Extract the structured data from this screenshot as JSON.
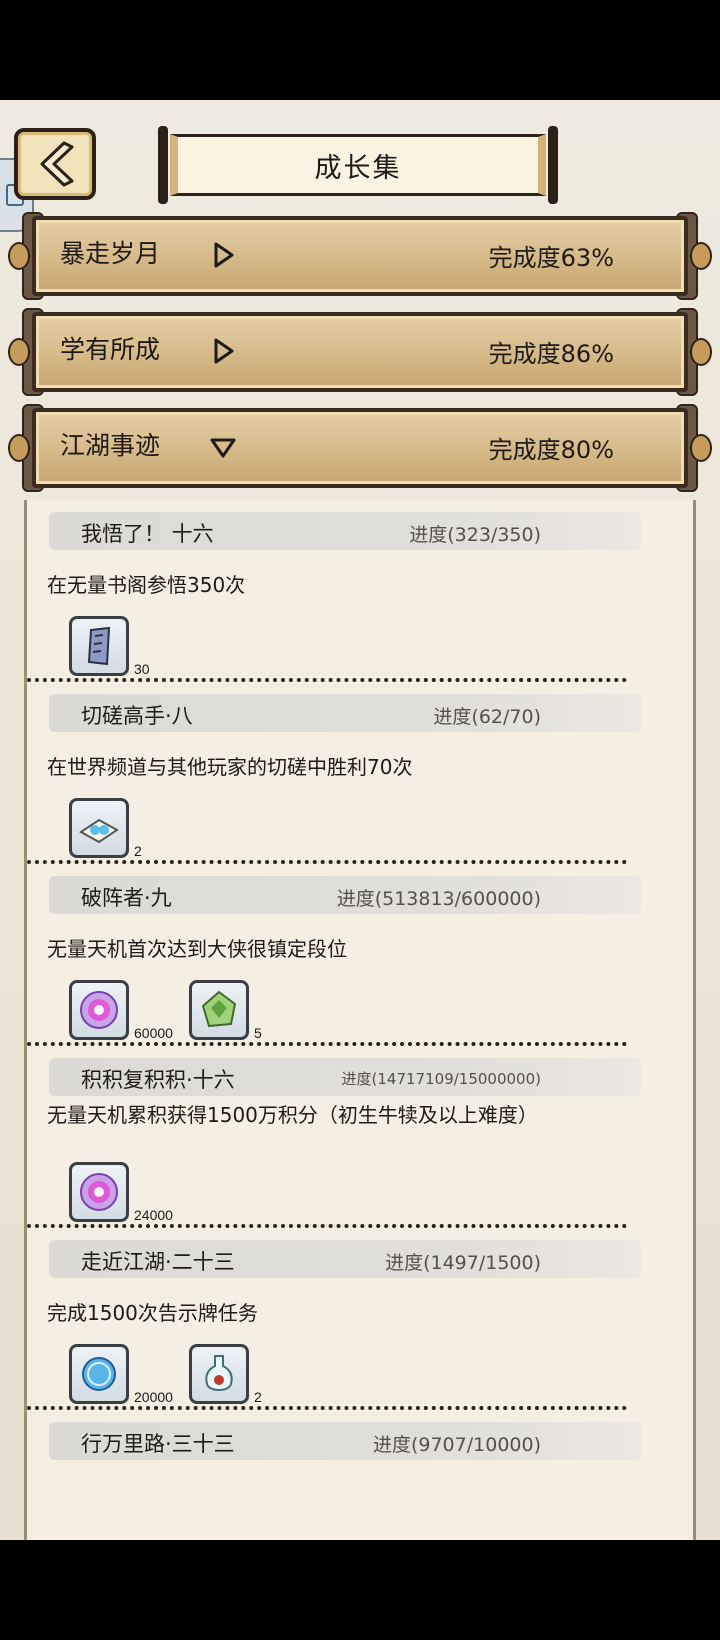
{
  "header": {
    "title": "成长集"
  },
  "categories": [
    {
      "name": "暴走岁月",
      "completion": "完成度63%",
      "expanded": false
    },
    {
      "name": "学有所成",
      "completion": "完成度86%",
      "expanded": false
    },
    {
      "name": "江湖事迹",
      "completion": "完成度80%",
      "expanded": true
    }
  ],
  "entries": [
    {
      "name": "我悟了！ 十六",
      "progress": "进度(323/350)",
      "desc": "在无量书阁参悟350次",
      "rewards": [
        {
          "icon": "scroll-fragment-icon",
          "count": "30"
        }
      ]
    },
    {
      "name": "切磋高手·八",
      "progress": "进度(62/70)",
      "desc": "在世界频道与其他玩家的切磋中胜利70次",
      "rewards": [
        {
          "icon": "jade-pearl-cloth-icon",
          "count": "2"
        }
      ]
    },
    {
      "name": "破阵者·九",
      "progress": "进度(513813/600000)",
      "desc": "无量天机首次达到大侠很镇定段位",
      "rewards": [
        {
          "icon": "purple-orb-icon",
          "count": "60000"
        },
        {
          "icon": "green-crystal-icon",
          "count": "5"
        }
      ]
    },
    {
      "name": "积积复积积·十六",
      "progress": "进度(14717109/15000000)",
      "desc": "无量天机累积获得1500万积分（初生牛犊及以上难度）",
      "rewards": [
        {
          "icon": "purple-orb-icon",
          "count": "24000"
        }
      ]
    },
    {
      "name": "走近江湖·二十三",
      "progress": "进度(1497/1500)",
      "desc": "完成1500次告示牌任务",
      "rewards": [
        {
          "icon": "blue-coin-icon",
          "count": "20000"
        },
        {
          "icon": "potion-bottle-icon",
          "count": "2"
        }
      ]
    },
    {
      "name": "行万里路·三十三",
      "progress": "进度(9707/10000)",
      "desc": "",
      "rewards": []
    }
  ]
}
